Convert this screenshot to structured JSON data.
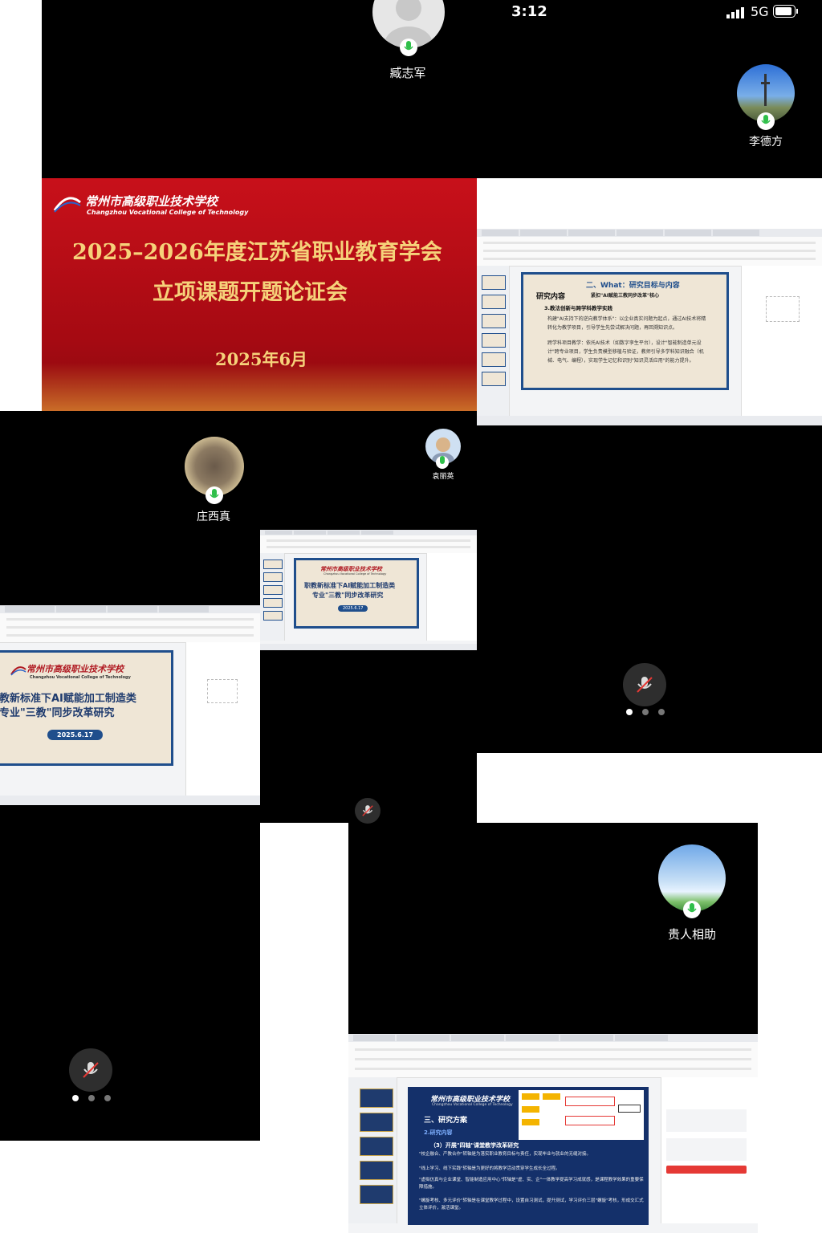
{
  "status_bar": {
    "time": "3:12",
    "network": "5G"
  },
  "participants": {
    "zang": {
      "name": "臧志军"
    },
    "li": {
      "name": "李德方"
    },
    "zhuang": {
      "name": "庄西真"
    },
    "yuan": {
      "name": "袁丽英"
    },
    "guiren": {
      "name": "贵人相助"
    }
  },
  "red_slide": {
    "school_cn": "常州市高级职业技术学校",
    "school_en": "Changzhou Vocational College of Technology",
    "title_line1": "2025–2026年度江苏省职业教育学会",
    "title_line2": "立项课题开题论证会",
    "date": "2025年6月"
  },
  "share_top": {
    "section": "二、What：研究目标与内容",
    "heading": "研究内容",
    "subheading": "紧扣\"AI赋能三教同步改革\"核心",
    "point_title": "3.教法创新与跨学科教学实践",
    "bullet1": "构建\"AI支持下的逆向教学体系\"：以企业真实问题为起点，通过AI技术将精转化为教学项目，引导学生先尝试解决问题，再回溯知识点。",
    "bullet2": "跨学科项目教学：依托AI技术（如数字孪生平台），设计\"智能制造单元设计\"跨专业项目，学生负责模型移植与验证，教师引导多学科知识融合（机械、电气、编程），实现学生记忆和识别\"知识灵活应用\"的能力提升。"
  },
  "share_mid": {
    "school_cn": "常州市高级职业技术学校",
    "school_en": "Changzhou Vocational College of Technology",
    "title_line1": "职教新标准下AI赋能加工制造类",
    "title_line2": "专业\"三教\"同步改革研究",
    "date": "2025.6.17"
  },
  "share_left": {
    "school_cn": "常州市高级职业技术学校",
    "school_en": "Changzhou Vocational College of Technology",
    "title_line1": "教新标准下AI赋能加工制造类",
    "title_line2": "专业\"三教\"同步改革研究",
    "date": "2025.6.17"
  },
  "share_bottom": {
    "school_cn": "常州市高级职业技术学校",
    "school_en": "Changzhou Vocational College of Technology",
    "section": "三、研究方案",
    "sub": "2.研究内容",
    "para_title": "（3）开展\"四轴\"课堂教学改革研究",
    "p1": "\"校企融合、产教合作\"转轴是为落实职业教育目标与责任，实现毕业与就业的无缝对接。",
    "p2": "\"线上学习、线下实践\"转轴是为更好的将教学活动贯穿学生成长全过程。",
    "p3": "\"虚拟仿真与企业课堂、智能制造应用中心\"转轴是\"虚、实、企\"一体教学提高学习成就感，是课程教学效果的重要保障措施。",
    "p4": "\"螺旋考核、多元评价\"转轴是在课堂教学过程中，设置自习测试，提升测试，学习评价三层\"螺旋\"考核，形成交汇式立体评价，激活课堂。"
  },
  "colors": {
    "accent_red": "#c8101a",
    "mic_green": "#2fbf4a",
    "navy": "#1f3b6e"
  },
  "icons": [
    "mic-icon",
    "mic-muted-icon",
    "signal-icon",
    "battery-icon"
  ]
}
